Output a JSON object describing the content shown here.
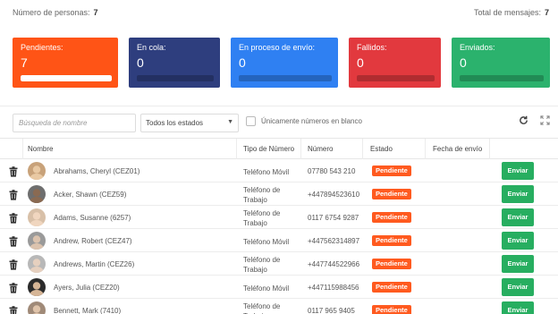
{
  "summary": {
    "personas_label": "Número de personas:",
    "personas_value": "7",
    "mensajes_label": "Total de mensajes:",
    "mensajes_value": "7"
  },
  "cards": [
    {
      "title": "Pendientes:",
      "value": "7",
      "color": "#ff5416",
      "progress": 1.0
    },
    {
      "title": "En cola:",
      "value": "0",
      "color": "#2e3e7e",
      "progress": 0
    },
    {
      "title": "En proceso de envío:",
      "value": "0",
      "color": "#2f80f2",
      "progress": 0
    },
    {
      "title": "Fallidos:",
      "value": "0",
      "color": "#e2393e",
      "progress": 0
    },
    {
      "title": "Enviados:",
      "value": "0",
      "color": "#2bb26d",
      "progress": 0
    }
  ],
  "toolbar": {
    "search_placeholder": "Búsqueda de nombre",
    "status_select": "Todos los estados",
    "blank_numbers_label": "Únicamente números en blanco",
    "refresh_icon": "refresh-icon",
    "expand_icon": "expand-icon"
  },
  "table": {
    "columns": [
      "Nombre",
      "Tipo de Número",
      "Número",
      "Estado",
      "Fecha de envío"
    ],
    "rows": [
      {
        "name": "Abrahams, Cheryl (CEZ01)",
        "tipo": "Teléfono Móvil",
        "numero": "07780 543 210",
        "estado": "Pendiente",
        "action": "Enviar",
        "avatar_bg": "#c8a27a",
        "avatar_face": "#e9c9a3"
      },
      {
        "name": "Acker, Shawn (CEZ59)",
        "tipo": "Teléfono de Trabajo",
        "numero": "+447894523610",
        "estado": "Pendiente",
        "action": "Enviar",
        "avatar_bg": "#6e6e6e",
        "avatar_face": "#8a6a52"
      },
      {
        "name": "Adams, Susanne (6257)",
        "tipo": "Teléfono de Trabajo",
        "numero": "0117 6754 9287",
        "estado": "Pendiente",
        "action": "Enviar",
        "avatar_bg": "#d8c0a8",
        "avatar_face": "#f0d6bf"
      },
      {
        "name": "Andrew, Robert (CEZ47)",
        "tipo": "Teléfono Móvil",
        "numero": "+447562314897",
        "estado": "Pendiente",
        "action": "Enviar",
        "avatar_bg": "#9a9a9a",
        "avatar_face": "#dcc3ae"
      },
      {
        "name": "Andrews, Martin (CEZ26)",
        "tipo": "Teléfono de Trabajo",
        "numero": "+447744522966",
        "estado": "Pendiente",
        "action": "Enviar",
        "avatar_bg": "#b8b8b8",
        "avatar_face": "#e6d0bf"
      },
      {
        "name": "Ayers, Julia (CEZ20)",
        "tipo": "Teléfono Móvil",
        "numero": "+447115988456",
        "estado": "Pendiente",
        "action": "Enviar",
        "avatar_bg": "#2b2b2b",
        "avatar_face": "#d6b596"
      },
      {
        "name": "Bennett, Mark (7410)",
        "tipo": "Teléfono de Trabajo",
        "numero": "0117 965 9405",
        "estado": "Pendiente",
        "action": "Enviar",
        "avatar_bg": "#a08a78",
        "avatar_face": "#e0c4aa"
      }
    ]
  }
}
